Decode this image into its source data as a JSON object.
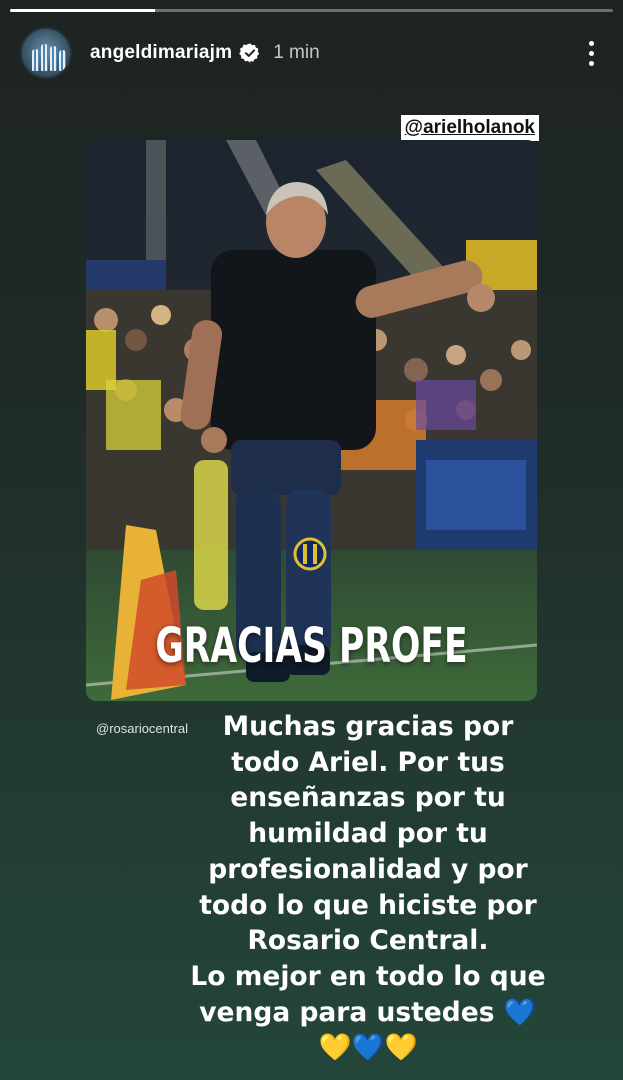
{
  "progress": {
    "fraction": 0.24
  },
  "header": {
    "username": "angeldimariajm",
    "time": "1 min",
    "verified": true
  },
  "stickers": {
    "mention": "@arielholanok",
    "source_tag": "@rosariocentral"
  },
  "photo": {
    "overlay_text": "GRACIAS PROFE"
  },
  "caption": {
    "lines": [
      "Muchas gracias por",
      "todo Ariel. Por tus",
      "enseñanzas por tu",
      "humildad por tu",
      "profesionalidad y por",
      "todo lo que hiciste por",
      "Rosario Central.",
      "Lo mejor en todo lo que",
      "venga para ustedes"
    ],
    "emoji_line_1": "💙",
    "emoji_line_2": [
      "💛",
      "💙",
      "💛"
    ]
  },
  "colors": {
    "heart_blue": "#2f7ce8",
    "heart_yellow": "#f2c230",
    "verified_badge": "#ffffff"
  }
}
